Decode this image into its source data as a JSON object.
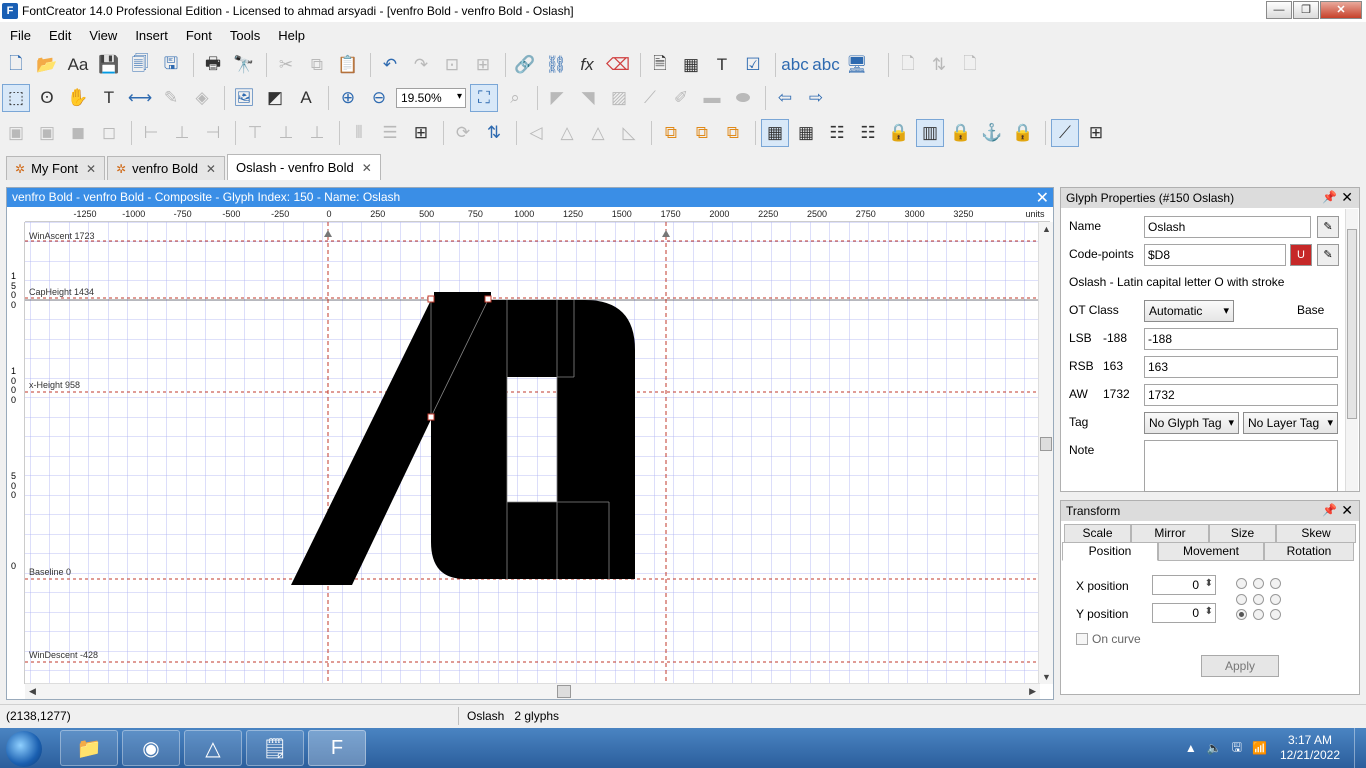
{
  "window": {
    "title": "FontCreator 14.0 Professional Edition - Licensed to ahmad arsyadi - [venfro Bold - venfro Bold - Oslash]",
    "app_icon": "F"
  },
  "menu": [
    "File",
    "Edit",
    "View",
    "Insert",
    "Font",
    "Tools",
    "Help"
  ],
  "toolbar": {
    "zoom": "19.50%"
  },
  "tabs": [
    {
      "label": "My Font",
      "icon": "gear-icon"
    },
    {
      "label": "venfro Bold",
      "icon": "gear-icon"
    },
    {
      "label": "Oslash - venfro Bold",
      "icon": ""
    }
  ],
  "editor": {
    "title": "venfro Bold - venfro Bold - Composite - Glyph Index: 150 - Name: Oslash",
    "ruler_ticks": [
      "-1250",
      "-1000",
      "-750",
      "-500",
      "-250",
      "0",
      "250",
      "500",
      "750",
      "1000",
      "1250",
      "1500",
      "1750",
      "2000",
      "2250",
      "2500",
      "2750",
      "3000",
      "3250"
    ],
    "ruler_units": "units",
    "v_ruler_labels": [
      "1\n5\n0\n0",
      "1\n0\n0\n0",
      "5\n0\n0",
      "0"
    ],
    "guides": {
      "win_ascent": "WinAscent 1723",
      "cap_height": "CapHeight 1434",
      "x_height": "x-Height 958",
      "baseline": "Baseline 0",
      "win_descent": "WinDescent -428"
    }
  },
  "glyph_properties": {
    "header": "Glyph Properties (#150 Oslash)",
    "name_label": "Name",
    "name_value": "Oslash",
    "codepoints_label": "Code-points",
    "codepoints_value": "$D8",
    "description": "Oslash - Latin capital letter O with stroke",
    "ot_class_label": "OT Class",
    "ot_class_value": "Automatic",
    "ot_class_extra": "Base",
    "lsb_label": "LSB",
    "lsb_current": "-188",
    "lsb_value": "-188",
    "rsb_label": "RSB",
    "rsb_current": "163",
    "rsb_value": "163",
    "aw_label": "AW",
    "aw_current": "1732",
    "aw_value": "1732",
    "tag_label": "Tag",
    "glyph_tag": "No Glyph Tag",
    "layer_tag": "No Layer Tag",
    "note_label": "Note"
  },
  "transform": {
    "header": "Transform",
    "tabs_top": [
      "Scale",
      "Mirror",
      "Size",
      "Skew"
    ],
    "tabs_bottom": [
      "Position",
      "Movement",
      "Rotation"
    ],
    "x_label": "X position",
    "x_value": "0",
    "y_label": "Y position",
    "y_value": "0",
    "on_curve_label": "On curve",
    "apply_label": "Apply"
  },
  "status": {
    "coords": "(2138,1277)",
    "glyph_info": "Oslash   2 glyphs"
  },
  "taskbar": {
    "time": "3:17 AM",
    "date": "12/21/2022"
  },
  "colors": {
    "accent": "#3a8ee6",
    "grid": "#9aa0f0",
    "guide": "#c0392b",
    "glyph": "#000000"
  }
}
